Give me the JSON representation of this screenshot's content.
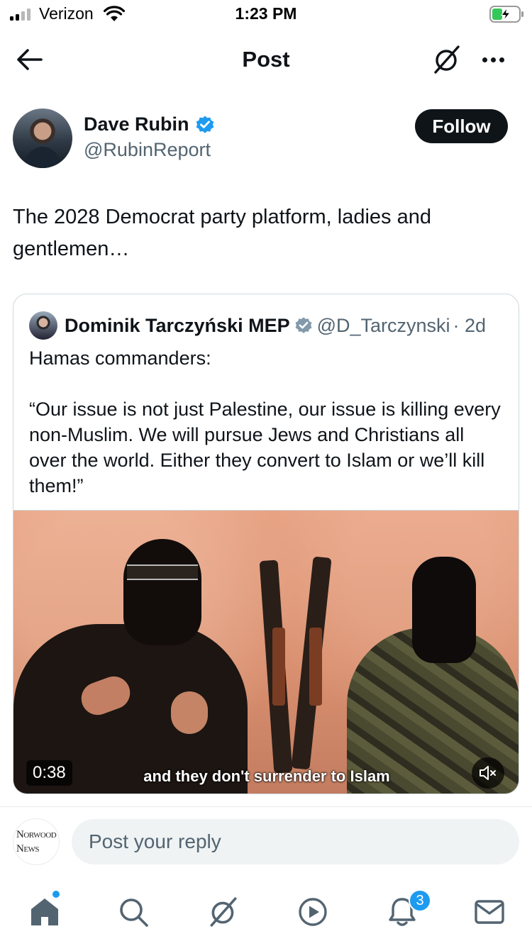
{
  "status_bar": {
    "carrier": "Verizon",
    "time": "1:23 PM"
  },
  "nav": {
    "title": "Post"
  },
  "post": {
    "author": {
      "name": "Dave Rubin",
      "handle": "@RubinReport",
      "verified": true
    },
    "follow_label": "Follow",
    "text": "The 2028 Democrat party platform, ladies and gentlemen…"
  },
  "quote": {
    "author": {
      "name": "Dominik Tarczyński MEP",
      "handle": "@D_Tarczynski",
      "age": "· 2d",
      "verified": true
    },
    "text_line1": "Hamas commanders:",
    "text_line2": "“Our issue is not just Palestine, our issue is killing every non-Muslim. We will pursue Jews and Christians all over the world. Either they convert to Islam or we’ll kill them!”",
    "video": {
      "duration": "0:38",
      "subtitle": "and they don't surrender to Islam",
      "muted": true
    }
  },
  "reply": {
    "placeholder": "Post your reply",
    "avatar_line1": "Norwood",
    "avatar_line2": "News"
  },
  "tabbar": {
    "notifications_count": "3",
    "items": [
      "home-icon",
      "search-icon",
      "grok-icon",
      "video-icon",
      "notifications-icon",
      "messages-icon"
    ]
  },
  "colors": {
    "accent": "#1d9bf0",
    "text": "#0f1419",
    "secondary_text": "#536471",
    "border": "#cfd9de",
    "input_bg": "#eff3f4",
    "battery_charging": "#34c759"
  }
}
